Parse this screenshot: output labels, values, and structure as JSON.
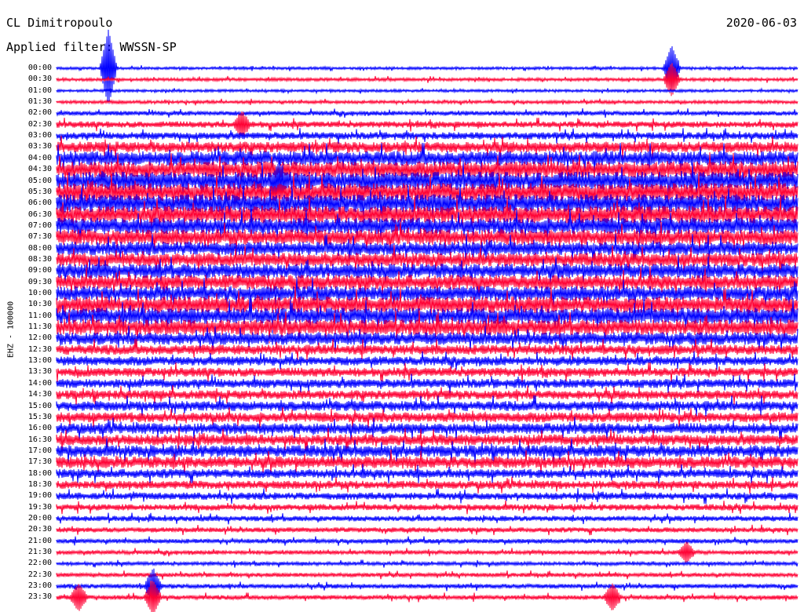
{
  "header": {
    "station": "CL Dimitropoulo",
    "filter": "Applied filter: WWSSN-SP",
    "date": "2020-06-03"
  },
  "chart_data": {
    "type": "helicorder",
    "channel_label": "EHZ - 100000",
    "row_labels": [
      "00:00",
      "00:30",
      "01:00",
      "01:30",
      "02:00",
      "02:30",
      "03:00",
      "03:30",
      "04:00",
      "04:30",
      "05:00",
      "05:30",
      "06:00",
      "06:30",
      "07:00",
      "07:30",
      "08:00",
      "08:30",
      "09:00",
      "09:30",
      "10:00",
      "10:30",
      "11:00",
      "11:30",
      "12:00",
      "12:30",
      "13:00",
      "13:30",
      "14:00",
      "14:30",
      "15:00",
      "15:30",
      "16:00",
      "16:30",
      "17:00",
      "17:30",
      "18:00",
      "18:30",
      "19:00",
      "19:30",
      "20:00",
      "20:30",
      "21:00",
      "21:30",
      "22:00",
      "22:30",
      "23:00",
      "23:30"
    ],
    "series_colors": [
      "#0000ff",
      "#ff0033"
    ],
    "relative_amplitude": [
      0.3,
      0.35,
      0.3,
      0.35,
      0.5,
      0.7,
      0.8,
      1.2,
      1.6,
      1.8,
      2.0,
      2.0,
      2.0,
      1.9,
      1.8,
      1.7,
      1.5,
      1.5,
      1.6,
      1.6,
      1.6,
      1.8,
      1.8,
      1.7,
      1.4,
      1.1,
      1.0,
      1.0,
      1.0,
      1.0,
      1.1,
      1.1,
      1.2,
      1.2,
      1.3,
      1.3,
      1.0,
      0.9,
      0.8,
      0.7,
      0.6,
      0.55,
      0.5,
      0.45,
      0.4,
      0.45,
      0.5,
      0.5
    ],
    "events": [
      {
        "row": 0,
        "time_fraction": 0.07,
        "amplitude": 6.0
      },
      {
        "row": 0,
        "time_fraction": 0.83,
        "amplitude": 3.5
      },
      {
        "row": 1,
        "time_fraction": 0.83,
        "amplitude": 2.5
      },
      {
        "row": 5,
        "time_fraction": 0.25,
        "amplitude": 1.8
      },
      {
        "row": 10,
        "time_fraction": 0.3,
        "amplitude": 2.0
      },
      {
        "row": 43,
        "time_fraction": 0.85,
        "amplitude": 1.5
      },
      {
        "row": 46,
        "time_fraction": 0.13,
        "amplitude": 2.5
      },
      {
        "row": 47,
        "time_fraction": 0.03,
        "amplitude": 2.0
      },
      {
        "row": 47,
        "time_fraction": 0.13,
        "amplitude": 2.5
      },
      {
        "row": 47,
        "time_fraction": 0.75,
        "amplitude": 2.0
      }
    ]
  }
}
